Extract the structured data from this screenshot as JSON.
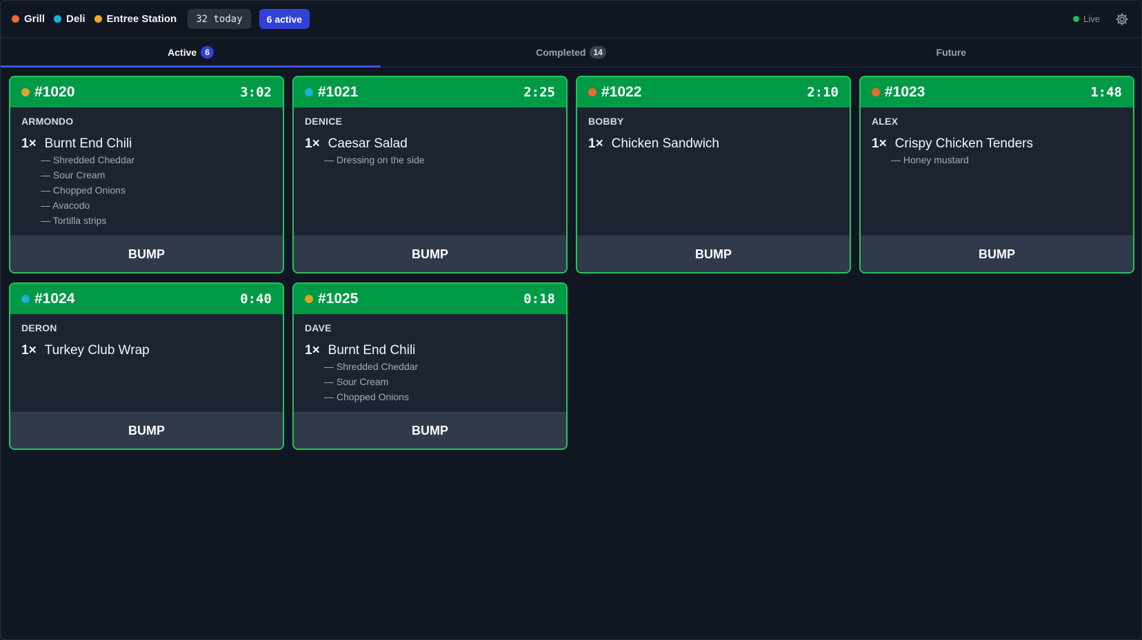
{
  "header": {
    "stations": [
      {
        "label": "Grill",
        "color": "#f06a2a"
      },
      {
        "label": "Deli",
        "color": "#1ab3d6"
      },
      {
        "label": "Entree Station",
        "color": "#f0a62a"
      }
    ],
    "today_pill": "32 today",
    "active_pill": "6 active",
    "live_label": "Live",
    "settings_icon": "gear-icon"
  },
  "tabs": [
    {
      "label": "Active",
      "count": "6",
      "selected": true
    },
    {
      "label": "Completed",
      "count": "14",
      "selected": false
    },
    {
      "label": "Future",
      "count": "",
      "selected": false
    }
  ],
  "tickets": [
    {
      "number": "#1020",
      "time": "3:02",
      "station_color": "#d9a52a",
      "customer": "ARMONDO",
      "items": [
        {
          "qty": "1×",
          "name": "Burnt End Chili",
          "mods": [
            "— Shredded Cheddar",
            "— Sour Cream",
            "— Chopped Onions",
            "— Avacodo",
            "— Tortilla strips"
          ]
        }
      ],
      "bump_label": "BUMP"
    },
    {
      "number": "#1021",
      "time": "2:25",
      "station_color": "#1ab3d6",
      "customer": "DENICE",
      "items": [
        {
          "qty": "1×",
          "name": "Caesar Salad",
          "mods": [
            "— Dressing on the side"
          ]
        }
      ],
      "bump_label": "BUMP"
    },
    {
      "number": "#1022",
      "time": "2:10",
      "station_color": "#f06a2a",
      "customer": "BOBBY",
      "items": [
        {
          "qty": "1×",
          "name": "Chicken Sandwich",
          "mods": []
        }
      ],
      "bump_label": "BUMP"
    },
    {
      "number": "#1023",
      "time": "1:48",
      "station_color": "#f06a2a",
      "customer": "ALEX",
      "items": [
        {
          "qty": "1×",
          "name": "Crispy Chicken Tenders",
          "mods": [
            "— Honey mustard"
          ]
        }
      ],
      "bump_label": "BUMP"
    },
    {
      "number": "#1024",
      "time": "0:40",
      "station_color": "#1ab3d6",
      "customer": "DERON",
      "items": [
        {
          "qty": "1×",
          "name": "Turkey Club Wrap",
          "mods": []
        }
      ],
      "bump_label": "BUMP"
    },
    {
      "number": "#1025",
      "time": "0:18",
      "station_color": "#d9a52a",
      "customer": "DAVE",
      "items": [
        {
          "qty": "1×",
          "name": "Burnt End Chili",
          "mods": [
            "— Shredded Cheddar",
            "— Sour Cream",
            "— Chopped Onions"
          ]
        }
      ],
      "bump_label": "BUMP"
    }
  ]
}
